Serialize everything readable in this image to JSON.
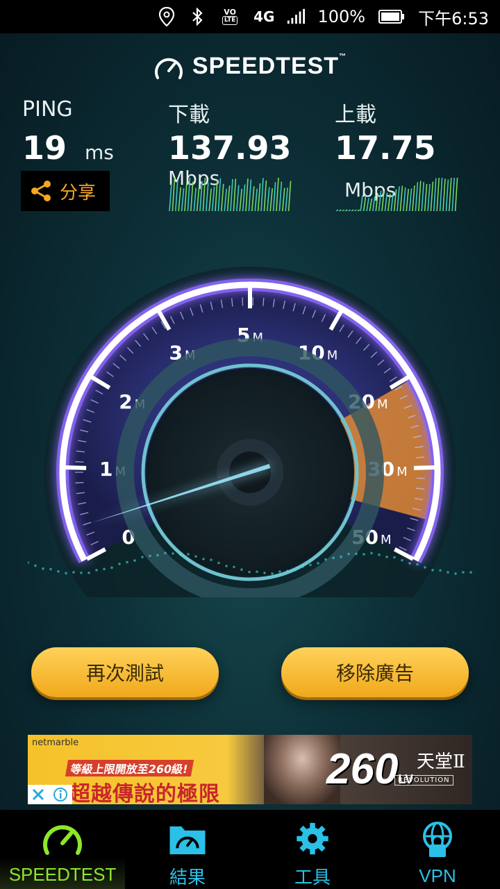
{
  "status_bar": {
    "network": "4G",
    "lte_badge_top": "VO",
    "lte_badge_bottom": "LTE",
    "battery": "100%",
    "time": "下午6:53",
    "icons": [
      "location-pin-icon",
      "bluetooth-icon",
      "volte-icon",
      "network-4g-icon",
      "signal-icon",
      "battery-icon"
    ]
  },
  "header": {
    "logo_text": "SPEEDTEST",
    "trademark": "™"
  },
  "ping": {
    "label": "PING",
    "value": "19",
    "unit": "ms"
  },
  "download": {
    "label": "下載",
    "value": "137.93",
    "unit": "Mbps"
  },
  "upload": {
    "label": "上載",
    "value": "17.75",
    "unit": "Mbps"
  },
  "share": {
    "label": "分享"
  },
  "gauge": {
    "labels": [
      {
        "num": "0",
        "unit": ""
      },
      {
        "num": "1",
        "unit": "M"
      },
      {
        "num": "2",
        "unit": "M"
      },
      {
        "num": "3",
        "unit": "M"
      },
      {
        "num": "5",
        "unit": "M"
      },
      {
        "num": "10",
        "unit": "M"
      },
      {
        "num": "20",
        "unit": "M"
      },
      {
        "num": "30",
        "unit": "M"
      },
      {
        "num": "50",
        "unit": "M"
      }
    ],
    "needle_value": 0.35,
    "colors": {
      "track": "#ffffff",
      "glow": "#8f6bff",
      "highlight": "#e08a35",
      "needle": "#9ee8ff"
    }
  },
  "buttons": {
    "retest": "再次測試",
    "remove_ads": "移除廣告"
  },
  "ad": {
    "brand": "netmarble",
    "headline": "等級上限開放至260級!",
    "tagline": "超越傳說的極限",
    "level": "260",
    "level_suffix": "LV",
    "game_title": "天堂Ⅱ",
    "game_subtitle": "REVOLUTION"
  },
  "tabs": [
    {
      "label": "SPEEDTEST",
      "icon": "speedometer-icon",
      "active": true
    },
    {
      "label": "結果",
      "icon": "results-folder-icon",
      "active": false
    },
    {
      "label": "工具",
      "icon": "gear-icon",
      "active": false
    },
    {
      "label": "VPN",
      "icon": "vpn-globe-lock-icon",
      "active": false
    }
  ]
}
